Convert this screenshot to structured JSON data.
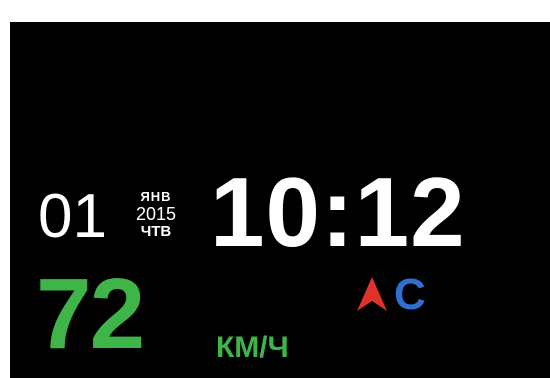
{
  "header_caption": "",
  "screen": {
    "date": {
      "day": "01",
      "month": "ЯНВ",
      "year": "2015",
      "weekday": "ЧТВ"
    },
    "time": "10:12",
    "speed": {
      "value": "72",
      "unit": "КМ/Ч"
    },
    "heading": {
      "icon": "north-arrow-icon",
      "direction": "С"
    }
  },
  "colors": {
    "background": "#000000",
    "text": "#ffffff",
    "speed": "#3fb449",
    "heading": "#2f6fcf",
    "compass": "#e0312b"
  }
}
